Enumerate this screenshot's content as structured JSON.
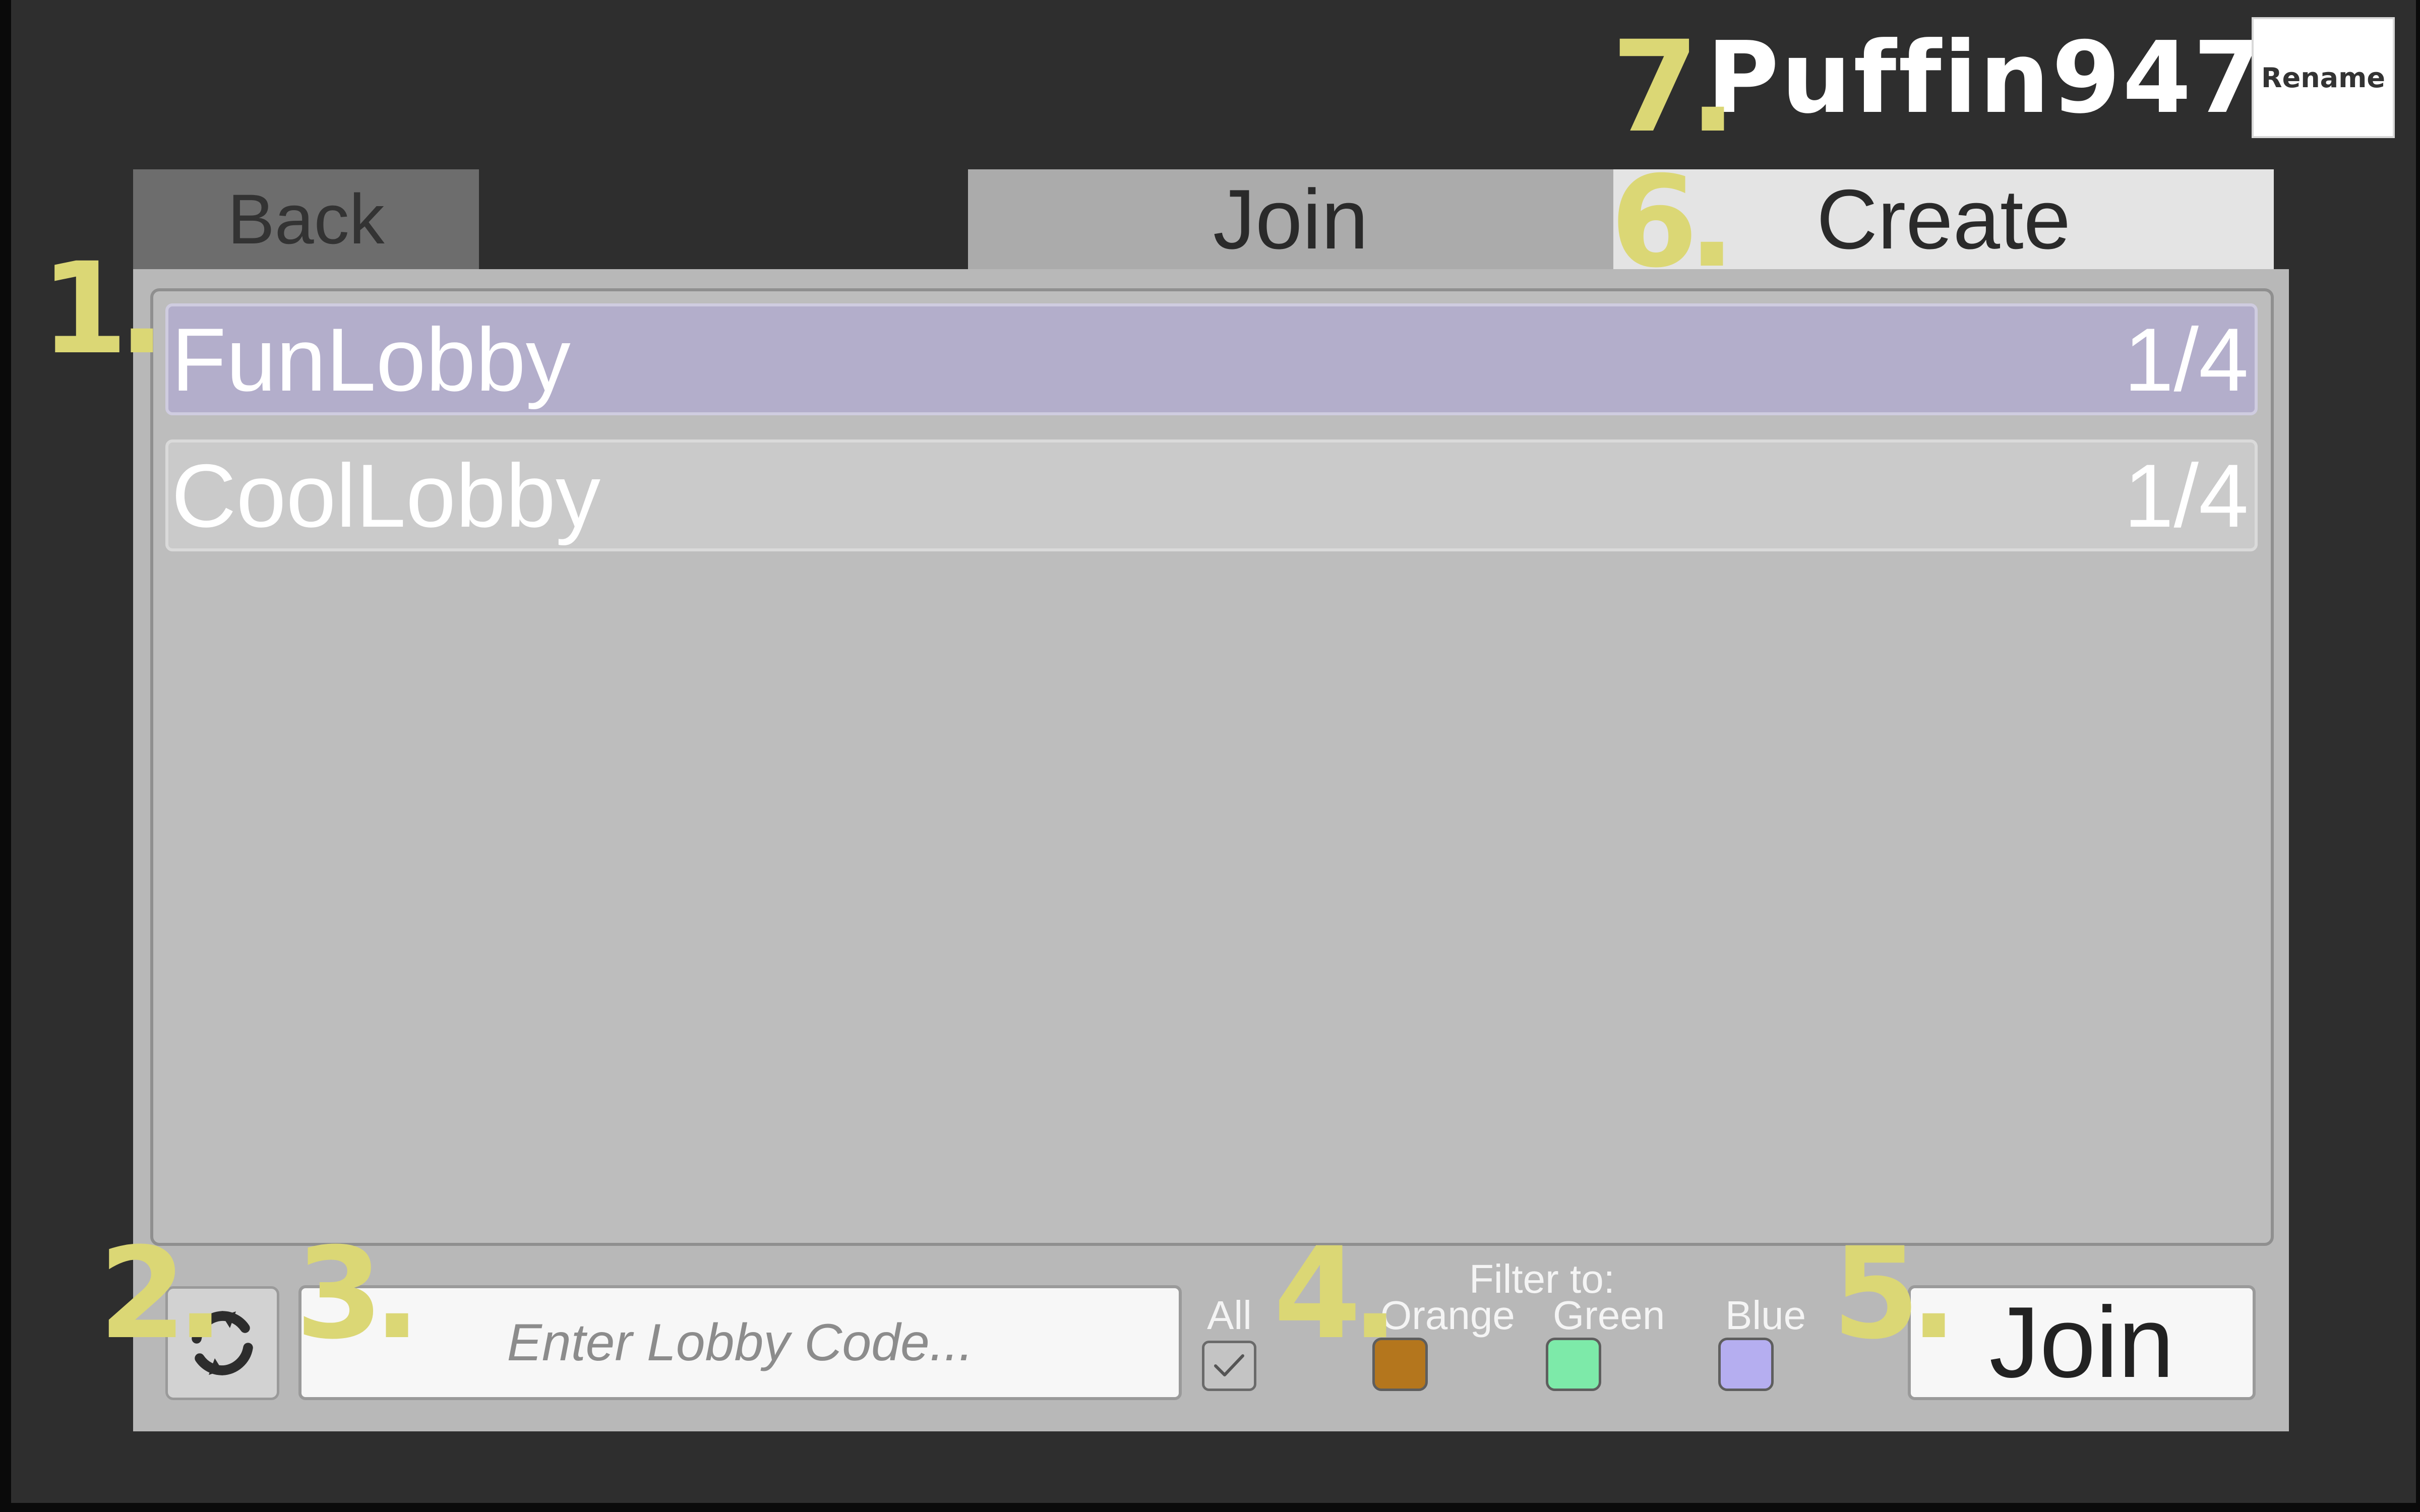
{
  "header": {
    "player_name": "Puffin947",
    "rename_label": "Rename"
  },
  "tabs": {
    "back_label": "Back",
    "join_label": "Join",
    "create_label": "Create"
  },
  "lobbies": [
    {
      "name": "FunLobby",
      "players": "1/4",
      "selected": true
    },
    {
      "name": "CoolLobby",
      "players": "1/4",
      "selected": false
    }
  ],
  "controls": {
    "refresh_icon": "refresh-icon",
    "lobby_code_placeholder": "Enter Lobby Code...",
    "all_label": "All",
    "all_checked": true,
    "filter_title": "Filter to:",
    "filters": [
      {
        "label": "Orange",
        "color": "#b4761d"
      },
      {
        "label": "Green",
        "color": "#7deaa9"
      },
      {
        "label": "Blue",
        "color": "#b5aef0"
      }
    ],
    "join_label": "Join"
  },
  "annotations": [
    "1.",
    "2.",
    "3.",
    "4.",
    "5.",
    "6.",
    "7."
  ],
  "colors": {
    "background": "#2e2e2e",
    "panel": "#b8b8b8",
    "selected_row": "#b3aecb",
    "annotation": "#dbd775"
  }
}
